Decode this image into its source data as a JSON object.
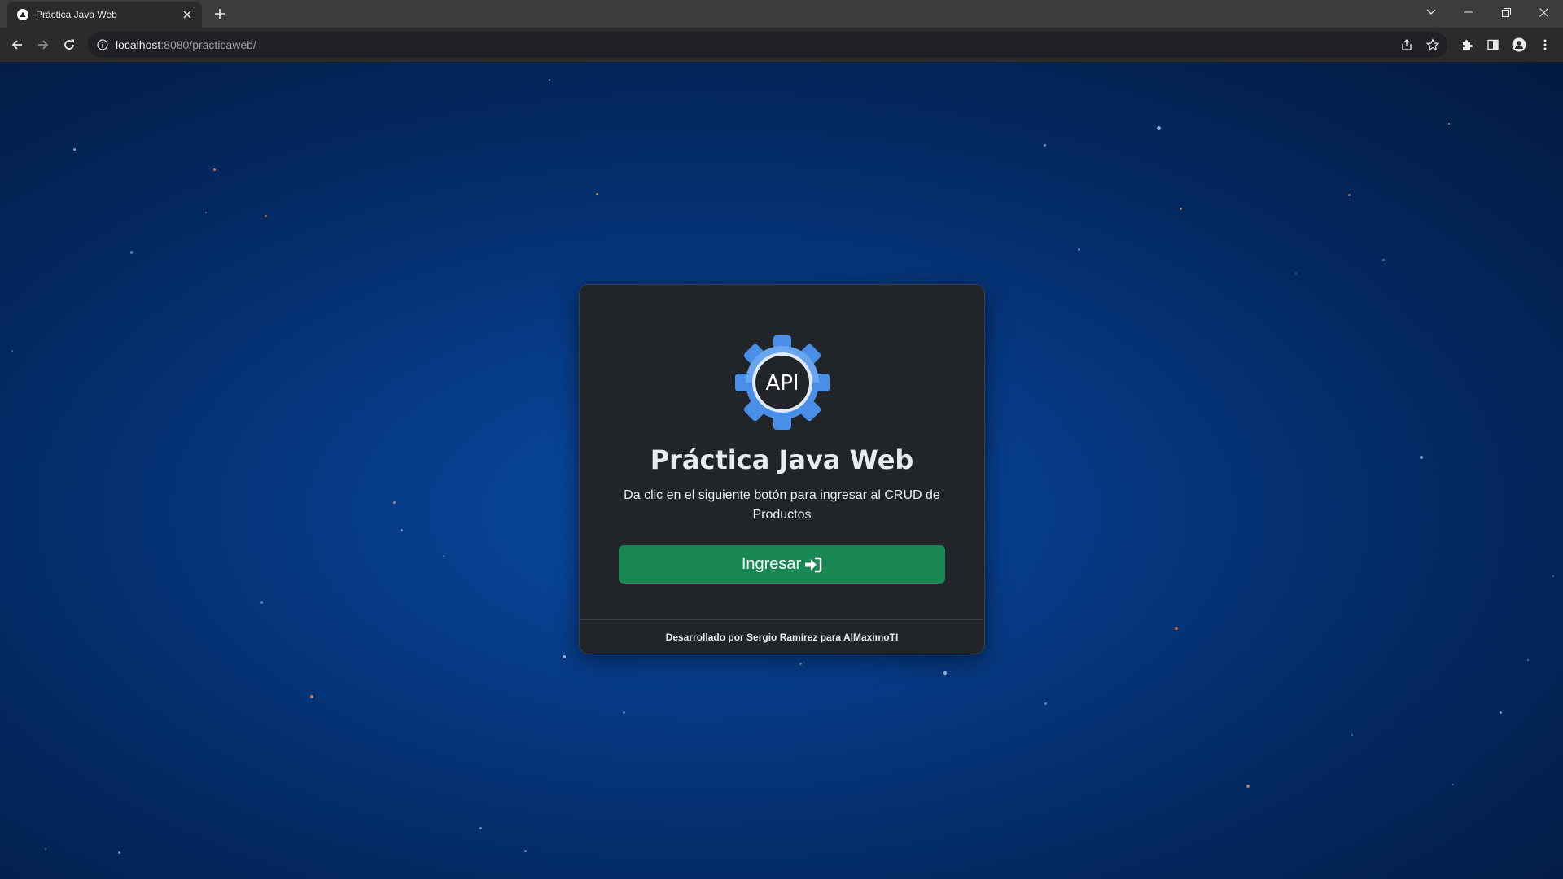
{
  "browser": {
    "tab_title": "Práctica Java Web",
    "url_host": "localhost",
    "url_rest": ":8080/practicaweb/"
  },
  "card": {
    "title": "Práctica Java Web",
    "logo_text": "API",
    "description": "Da clic en el siguiente botón para ingresar al CRUD de Productos",
    "button_label": "Ingresar",
    "footer": "Desarrollado por Sergio Ramírez para AlMaximoTI"
  },
  "colors": {
    "background": "#063a85",
    "card": "#212529",
    "button": "#198754",
    "logo_blue": "#4a8fe7"
  },
  "icons": {
    "favicon": "triangle-icon",
    "login": "sign-in-icon"
  }
}
